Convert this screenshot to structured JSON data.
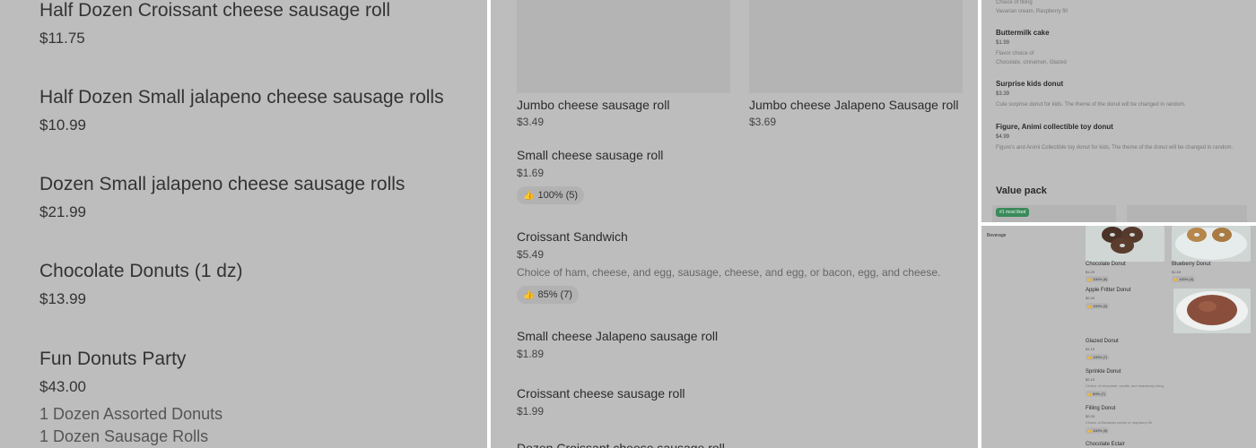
{
  "panel1": {
    "items": [
      {
        "name": "Half Dozen Croissant cheese sausage roll",
        "price": "$11.75"
      },
      {
        "name": "Half Dozen Small jalapeno cheese sausage rolls",
        "price": "$10.99"
      },
      {
        "name": "Dozen Small jalapeno cheese sausage rolls",
        "price": "$21.99"
      },
      {
        "name": "Chocolate Donuts (1 dz)",
        "price": "$13.99"
      },
      {
        "name": "Fun Donuts Party",
        "price": "$43.00",
        "desc1": "1 Dozen Assorted Donuts",
        "desc2": "1 Dozen Sausage Rolls"
      }
    ]
  },
  "panel2": {
    "tiles": [
      {
        "name": "Jumbo cheese sausage roll",
        "price": "$3.49"
      },
      {
        "name": "Jumbo cheese Jalapeno Sausage roll",
        "price": "$3.69"
      }
    ],
    "items": [
      {
        "name": "Small cheese sausage roll",
        "price": "$1.69",
        "badge": "100% (5)"
      },
      {
        "name": "Croissant Sandwich",
        "price": "$5.49",
        "desc": "Choice of ham, cheese, and egg, sausage, cheese, and egg, or bacon, egg, and cheese.",
        "badge": "85% (7)"
      },
      {
        "name": "Small cheese Jalapeno sausage roll",
        "price": "$1.89"
      },
      {
        "name": "Croissant cheese sausage roll",
        "price": "$1.99"
      },
      {
        "name": "Dozen Croissant cheese sausage roll"
      }
    ]
  },
  "panel3": {
    "top_line1": "Choice of filling",
    "top_line2": "Vavarian cream, Raspberry fill",
    "items": [
      {
        "name": "Buttermilk cake",
        "price": "$1.99",
        "desc1": "Flavor choice of",
        "desc2": "Chocolate, cinnamon, Glazed"
      },
      {
        "name": "Surprise kids donut",
        "price": "$3.39",
        "desc1": "Cute surprise donut for kids. The theme of the donut will be changed in random."
      },
      {
        "name": "Figure, Animi collectible toy donut",
        "price": "$4.99",
        "desc1": "Figure's and Animi Collectible toy donut for kids, The theme of the donut will be changed in random."
      }
    ],
    "section": "Value pack",
    "most_liked": "#1 most liked"
  },
  "panel4": {
    "category": "Beverage",
    "items": [
      {
        "name": "Chocolate Donut",
        "price": "$1.29",
        "badge": "100% (6)"
      },
      {
        "name": "Blueberry Donut",
        "price": "$1.59",
        "badge": "100% (4)"
      },
      {
        "name": "Apple Fritter Donut",
        "price": "$2.49",
        "badge": "100% (2)"
      },
      {
        "name": "Glazed Donut",
        "price": "$1.19",
        "badge": "100% (7)"
      },
      {
        "name": "Sprinkle Donut",
        "price": "$2.19",
        "desc": "Choice of chocolate, vanilla, and strawberry icing.",
        "badge": "89% (7)"
      },
      {
        "name": "Filling Donut",
        "price": "$2.29",
        "desc": "Choice of Bavarian cream or raspberry fill.",
        "badge": "100% (5)"
      },
      {
        "name": "Chocolate Eclair"
      }
    ]
  },
  "colors": {
    "panel_bg": "#bdbdbd",
    "accent_green": "#3a8a5a",
    "image_placeholder": "#b4b4b4"
  }
}
